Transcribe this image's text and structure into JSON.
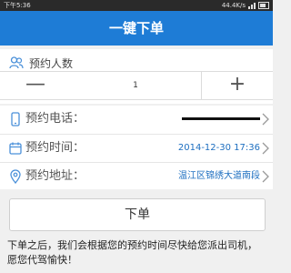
{
  "status": {
    "time": "下午5:36",
    "speed": "44.4K/s"
  },
  "header": {
    "title": "一键下单"
  },
  "passengers": {
    "label": "预约人数",
    "minus": "—",
    "value": "1",
    "plus": "+"
  },
  "form": {
    "phone": {
      "label": "预约电话："
    },
    "time": {
      "label": "预约时间：",
      "value": "2014-12-30 17:36"
    },
    "address": {
      "label": "预约地址：",
      "value": "温江区锦绣大道南段"
    }
  },
  "submit_label": "下单",
  "notice": "下单之后，我们会根据您的预约时间尽快给您派出司机，愿您代驾愉快！",
  "colors": {
    "accent": "#1e7cd6",
    "value_text": "#1e6fc0"
  }
}
